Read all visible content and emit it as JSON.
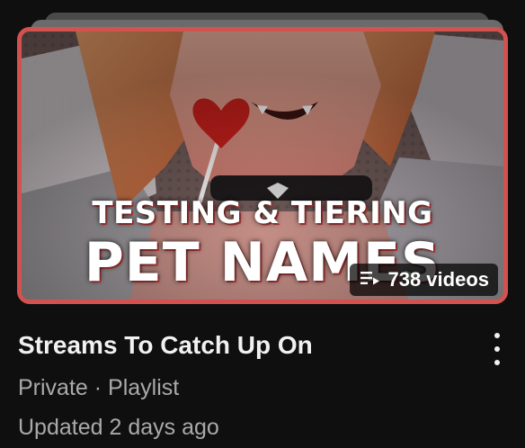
{
  "thumbnail": {
    "line1": "TESTING & TIERING",
    "line2": "PET NAMES",
    "video_count": "738 videos",
    "count_icon": "playlist-icon",
    "accent_color": "#d3524f"
  },
  "playlist": {
    "title": "Streams To Catch Up On",
    "visibility": "Private",
    "separator": "·",
    "type": "Playlist",
    "updated": "Updated 2 days ago"
  },
  "menu": {
    "icon": "more-vertical-icon"
  }
}
